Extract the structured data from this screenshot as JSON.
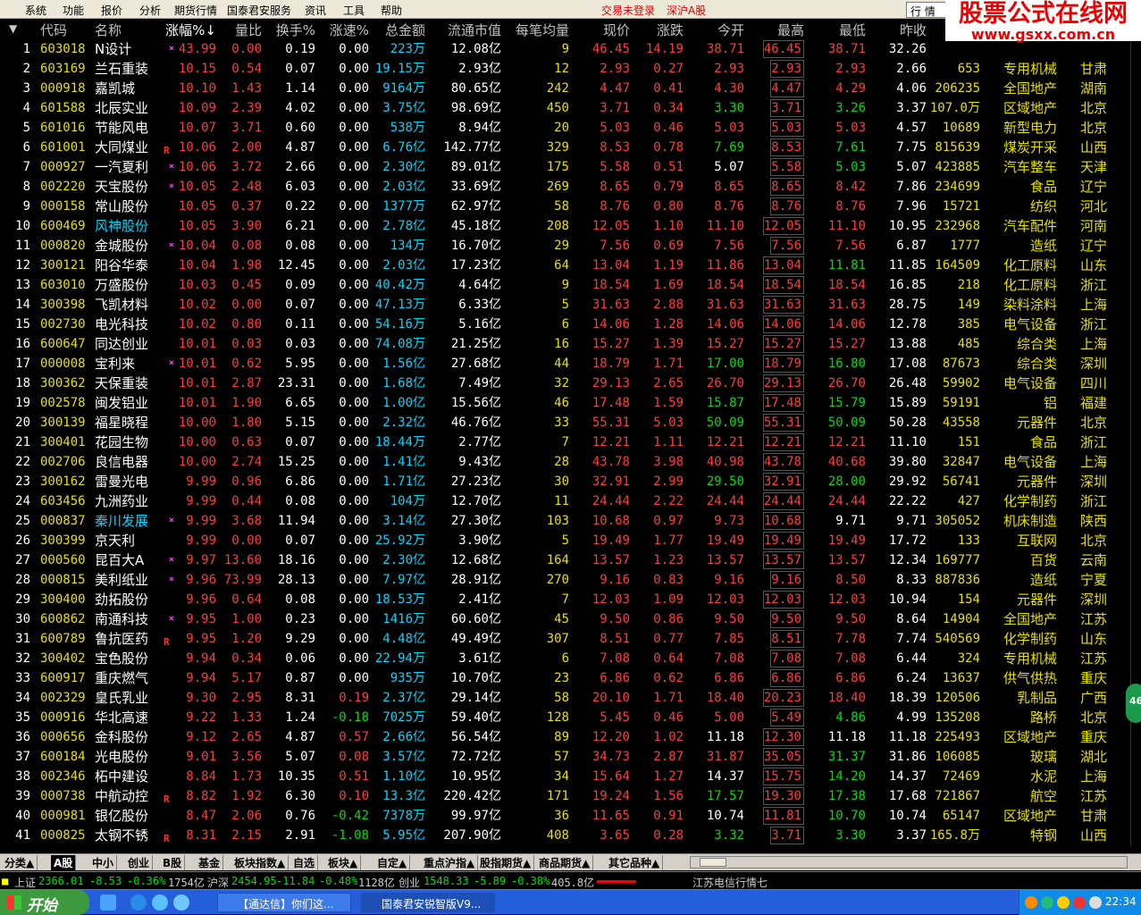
{
  "menu": [
    "系统",
    "功能",
    "报价",
    "分析",
    "期货行情",
    "国泰君安服务",
    "资讯",
    "工具",
    "帮助"
  ],
  "login_status": "交易未登录",
  "market": "深沪A股",
  "quote_button": "行 情",
  "watermark": {
    "title": "股票公式在线网",
    "url": "www.gsxx.com.cn"
  },
  "headers": [
    "代码",
    "名称",
    "涨幅%↓",
    "量比",
    "换手%",
    "涨速%",
    "总金额",
    "流通市值",
    "每笔均量",
    "现价",
    "涨跌",
    "今开",
    "最高",
    "最低",
    "昨收",
    "",
    ""
  ],
  "menu_arrow": "▼",
  "colors": {
    "up": "#ff3c3c",
    "down": "#00e000",
    "flat": "#ffffff",
    "yellow": "#e8e000",
    "cyan": "#00d8ff",
    "code": "#e8e000",
    "volume": "#e8e000",
    "header": "#c0c0c0"
  },
  "rows": [
    [
      "1",
      "603018",
      "N设计",
      "×",
      "43.99",
      "0.00",
      "0.19",
      "0.00",
      "223万",
      "12.08亿",
      "9",
      "46.45",
      "14.19",
      "38.71",
      "46.45",
      "38.71",
      "32.26",
      "",
      ""
    ],
    [
      "2",
      "603169",
      "兰石重装",
      "",
      "10.15",
      "0.54",
      "0.07",
      "0.00",
      "19.15万",
      "2.93亿",
      "12",
      "2.93",
      "0.27",
      "2.93",
      "2.93",
      "2.93",
      "2.66",
      "653",
      "专用机械",
      "甘肃"
    ],
    [
      "3",
      "000918",
      "嘉凯城",
      "",
      "10.10",
      "1.43",
      "1.14",
      "0.00",
      "9164万",
      "80.65亿",
      "242",
      "4.47",
      "0.41",
      "4.30",
      "4.47",
      "4.29",
      "4.06",
      "206235",
      "全国地产",
      "湖南"
    ],
    [
      "4",
      "601588",
      "北辰实业",
      "",
      "10.09",
      "2.39",
      "4.02",
      "0.00",
      "3.75亿",
      "98.69亿",
      "450",
      "3.71",
      "0.34",
      "3.30",
      "3.71",
      "3.26",
      "3.37",
      "107.0万",
      "区域地产",
      "北京"
    ],
    [
      "5",
      "601016",
      "节能风电",
      "",
      "10.07",
      "3.71",
      "0.60",
      "0.00",
      "538万",
      "8.94亿",
      "20",
      "5.03",
      "0.46",
      "5.03",
      "5.03",
      "5.03",
      "4.57",
      "10689",
      "新型电力",
      "北京"
    ],
    [
      "6",
      "601001",
      "大同煤业",
      "R",
      "10.06",
      "2.00",
      "4.87",
      "0.00",
      "6.76亿",
      "142.77亿",
      "329",
      "8.53",
      "0.78",
      "7.69",
      "8.53",
      "7.61",
      "7.75",
      "815639",
      "煤炭开采",
      "山西"
    ],
    [
      "7",
      "000927",
      "一汽夏利",
      "×",
      "10.06",
      "3.72",
      "2.66",
      "0.00",
      "2.30亿",
      "89.01亿",
      "175",
      "5.58",
      "0.51",
      "5.07",
      "5.58",
      "5.03",
      "5.07",
      "423885",
      "汽车整车",
      "天津"
    ],
    [
      "8",
      "002220",
      "天宝股份",
      "×",
      "10.05",
      "2.48",
      "6.03",
      "0.00",
      "2.03亿",
      "33.69亿",
      "269",
      "8.65",
      "0.79",
      "8.65",
      "8.65",
      "8.42",
      "7.86",
      "234699",
      "食品",
      "辽宁"
    ],
    [
      "9",
      "000158",
      "常山股份",
      "",
      "10.05",
      "0.37",
      "0.22",
      "0.00",
      "1377万",
      "62.97亿",
      "58",
      "8.76",
      "0.80",
      "8.76",
      "8.76",
      "8.76",
      "7.96",
      "15721",
      "纺织",
      "河北"
    ],
    [
      "10",
      "600469",
      "风神股份",
      "",
      "10.05",
      "3.90",
      "6.21",
      "0.00",
      "2.78亿",
      "45.18亿",
      "208",
      "12.05",
      "1.10",
      "11.10",
      "12.05",
      "11.10",
      "10.95",
      "232968",
      "汽车配件",
      "河南"
    ],
    [
      "11",
      "000820",
      "金城股份",
      "×",
      "10.04",
      "0.08",
      "0.08",
      "0.00",
      "134万",
      "16.70亿",
      "29",
      "7.56",
      "0.69",
      "7.56",
      "7.56",
      "7.56",
      "6.87",
      "1777",
      "造纸",
      "辽宁"
    ],
    [
      "12",
      "300121",
      "阳谷华泰",
      "",
      "10.04",
      "1.98",
      "12.45",
      "0.00",
      "2.03亿",
      "17.23亿",
      "64",
      "13.04",
      "1.19",
      "11.86",
      "13.04",
      "11.81",
      "11.85",
      "164509",
      "化工原料",
      "山东"
    ],
    [
      "13",
      "603010",
      "万盛股份",
      "",
      "10.03",
      "0.45",
      "0.09",
      "0.00",
      "40.42万",
      "4.64亿",
      "9",
      "18.54",
      "1.69",
      "18.54",
      "18.54",
      "18.54",
      "16.85",
      "218",
      "化工原料",
      "浙江"
    ],
    [
      "14",
      "300398",
      "飞凯材料",
      "",
      "10.02",
      "0.00",
      "0.07",
      "0.00",
      "47.13万",
      "6.33亿",
      "5",
      "31.63",
      "2.88",
      "31.63",
      "31.63",
      "31.63",
      "28.75",
      "149",
      "染料涂料",
      "上海"
    ],
    [
      "15",
      "002730",
      "电光科技",
      "",
      "10.02",
      "0.80",
      "0.11",
      "0.00",
      "54.16万",
      "5.16亿",
      "6",
      "14.06",
      "1.28",
      "14.06",
      "14.06",
      "14.06",
      "12.78",
      "385",
      "电气设备",
      "浙江"
    ],
    [
      "16",
      "600647",
      "同达创业",
      "",
      "10.01",
      "0.03",
      "0.03",
      "0.00",
      "74.08万",
      "21.25亿",
      "16",
      "15.27",
      "1.39",
      "15.27",
      "15.27",
      "15.27",
      "13.88",
      "485",
      "综合类",
      "上海"
    ],
    [
      "17",
      "000008",
      "宝利来",
      "×",
      "10.01",
      "0.62",
      "5.95",
      "0.00",
      "1.56亿",
      "27.68亿",
      "44",
      "18.79",
      "1.71",
      "17.00",
      "18.79",
      "16.80",
      "17.08",
      "87673",
      "综合类",
      "深圳"
    ],
    [
      "18",
      "300362",
      "天保重装",
      "",
      "10.01",
      "2.87",
      "23.31",
      "0.00",
      "1.68亿",
      "7.49亿",
      "32",
      "29.13",
      "2.65",
      "26.70",
      "29.13",
      "26.70",
      "26.48",
      "59902",
      "电气设备",
      "四川"
    ],
    [
      "19",
      "002578",
      "闽发铝业",
      "",
      "10.01",
      "1.90",
      "6.65",
      "0.00",
      "1.00亿",
      "15.56亿",
      "46",
      "17.48",
      "1.59",
      "15.87",
      "17.48",
      "15.79",
      "15.89",
      "59191",
      "铝",
      "福建"
    ],
    [
      "20",
      "300139",
      "福星晓程",
      "",
      "10.00",
      "1.80",
      "5.15",
      "0.00",
      "2.32亿",
      "46.76亿",
      "33",
      "55.31",
      "5.03",
      "50.09",
      "55.31",
      "50.09",
      "50.28",
      "43558",
      "元器件",
      "北京"
    ],
    [
      "21",
      "300401",
      "花园生物",
      "",
      "10.00",
      "0.63",
      "0.07",
      "0.00",
      "18.44万",
      "2.77亿",
      "7",
      "12.21",
      "1.11",
      "12.21",
      "12.21",
      "12.21",
      "11.10",
      "151",
      "食品",
      "浙江"
    ],
    [
      "22",
      "002706",
      "良信电器",
      "",
      "10.00",
      "2.74",
      "15.25",
      "0.00",
      "1.41亿",
      "9.43亿",
      "28",
      "43.78",
      "3.98",
      "40.98",
      "43.78",
      "40.68",
      "39.80",
      "32847",
      "电气设备",
      "上海"
    ],
    [
      "23",
      "300162",
      "雷曼光电",
      "",
      "9.99",
      "0.96",
      "6.86",
      "0.00",
      "1.71亿",
      "27.23亿",
      "30",
      "32.91",
      "2.99",
      "29.50",
      "32.91",
      "28.00",
      "29.92",
      "56741",
      "元器件",
      "深圳"
    ],
    [
      "24",
      "603456",
      "九洲药业",
      "",
      "9.99",
      "0.44",
      "0.08",
      "0.00",
      "104万",
      "12.70亿",
      "11",
      "24.44",
      "2.22",
      "24.44",
      "24.44",
      "24.44",
      "22.22",
      "427",
      "化学制药",
      "浙江"
    ],
    [
      "25",
      "000837",
      "秦川发展",
      "×",
      "9.99",
      "3.68",
      "11.94",
      "0.00",
      "3.14亿",
      "27.30亿",
      "103",
      "10.68",
      "0.97",
      "9.73",
      "10.68",
      "9.71",
      "9.71",
      "305052",
      "机床制造",
      "陕西"
    ],
    [
      "26",
      "300399",
      "京天利",
      "",
      "9.99",
      "0.00",
      "0.07",
      "0.00",
      "25.92万",
      "3.90亿",
      "5",
      "19.49",
      "1.77",
      "19.49",
      "19.49",
      "19.49",
      "17.72",
      "133",
      "互联网",
      "北京"
    ],
    [
      "27",
      "000560",
      "昆百大A",
      "×",
      "9.97",
      "13.60",
      "18.16",
      "0.00",
      "2.30亿",
      "12.68亿",
      "164",
      "13.57",
      "1.23",
      "13.57",
      "13.57",
      "13.57",
      "12.34",
      "169777",
      "百货",
      "云南"
    ],
    [
      "28",
      "000815",
      "美利纸业",
      "×",
      "9.96",
      "73.99",
      "28.13",
      "0.00",
      "7.97亿",
      "28.91亿",
      "270",
      "9.16",
      "0.83",
      "9.16",
      "9.16",
      "8.50",
      "8.33",
      "887836",
      "造纸",
      "宁夏"
    ],
    [
      "29",
      "300400",
      "劲拓股份",
      "",
      "9.96",
      "0.64",
      "0.08",
      "0.00",
      "18.53万",
      "2.41亿",
      "7",
      "12.03",
      "1.09",
      "12.03",
      "12.03",
      "12.03",
      "10.94",
      "154",
      "元器件",
      "深圳"
    ],
    [
      "30",
      "600862",
      "南通科技",
      "×",
      "9.95",
      "1.00",
      "0.23",
      "0.00",
      "1416万",
      "60.60亿",
      "45",
      "9.50",
      "0.86",
      "9.50",
      "9.50",
      "9.50",
      "8.64",
      "14904",
      "全国地产",
      "江苏"
    ],
    [
      "31",
      "600789",
      "鲁抗医药",
      "R",
      "9.95",
      "1.20",
      "9.29",
      "0.00",
      "4.48亿",
      "49.49亿",
      "307",
      "8.51",
      "0.77",
      "7.85",
      "8.51",
      "7.78",
      "7.74",
      "540569",
      "化学制药",
      "山东"
    ],
    [
      "32",
      "300402",
      "宝色股份",
      "",
      "9.94",
      "0.34",
      "0.06",
      "0.00",
      "22.94万",
      "3.61亿",
      "6",
      "7.08",
      "0.64",
      "7.08",
      "7.08",
      "7.08",
      "6.44",
      "324",
      "专用机械",
      "江苏"
    ],
    [
      "33",
      "600917",
      "重庆燃气",
      "",
      "9.94",
      "5.17",
      "0.87",
      "0.00",
      "935万",
      "10.70亿",
      "23",
      "6.86",
      "0.62",
      "6.86",
      "6.86",
      "6.86",
      "6.24",
      "13637",
      "供气供热",
      "重庆"
    ],
    [
      "34",
      "002329",
      "皇氏乳业",
      "",
      "9.30",
      "2.95",
      "8.31",
      "0.19",
      "2.37亿",
      "29.14亿",
      "58",
      "20.10",
      "1.71",
      "18.40",
      "20.23",
      "18.40",
      "18.39",
      "120506",
      "乳制品",
      "广西"
    ],
    [
      "35",
      "000916",
      "华北高速",
      "",
      "9.22",
      "1.33",
      "1.24",
      "-0.18",
      "7025万",
      "59.40亿",
      "128",
      "5.45",
      "0.46",
      "5.00",
      "5.49",
      "4.86",
      "4.99",
      "135208",
      "路桥",
      "北京"
    ],
    [
      "36",
      "000656",
      "金科股份",
      "",
      "9.12",
      "2.65",
      "4.87",
      "0.57",
      "2.66亿",
      "56.54亿",
      "89",
      "12.20",
      "1.02",
      "11.18",
      "12.30",
      "11.18",
      "11.18",
      "225493",
      "区域地产",
      "重庆"
    ],
    [
      "37",
      "600184",
      "光电股份",
      "",
      "9.01",
      "3.56",
      "5.07",
      "0.08",
      "3.57亿",
      "72.72亿",
      "57",
      "34.73",
      "2.87",
      "31.87",
      "35.05",
      "31.37",
      "31.86",
      "106085",
      "玻璃",
      "湖北"
    ],
    [
      "38",
      "002346",
      "柘中建设",
      "",
      "8.84",
      "1.73",
      "10.35",
      "0.51",
      "1.10亿",
      "10.95亿",
      "34",
      "15.64",
      "1.27",
      "14.37",
      "15.75",
      "14.20",
      "14.37",
      "72469",
      "水泥",
      "上海"
    ],
    [
      "39",
      "000738",
      "中航动控",
      "R",
      "8.82",
      "1.92",
      "6.30",
      "0.10",
      "13.3亿",
      "220.42亿",
      "171",
      "19.24",
      "1.56",
      "17.57",
      "19.30",
      "17.38",
      "17.68",
      "721867",
      "航空",
      "江苏"
    ],
    [
      "40",
      "000981",
      "银亿股份",
      "",
      "8.47",
      "2.06",
      "0.76",
      "-0.42",
      "7378万",
      "99.97亿",
      "36",
      "11.65",
      "0.91",
      "10.74",
      "11.81",
      "10.70",
      "10.74",
      "65147",
      "区域地产",
      "甘肃"
    ],
    [
      "41",
      "000825",
      "太钢不锈",
      "R",
      "8.31",
      "2.15",
      "2.91",
      "-1.08",
      "5.95亿",
      "207.90亿",
      "408",
      "3.65",
      "0.28",
      "3.32",
      "3.71",
      "3.30",
      "3.37",
      "165.8万",
      "特钢",
      "山西"
    ]
  ],
  "tabs": [
    "分类▲",
    "A股",
    "中小",
    "创业",
    "B股",
    "基金",
    "板块指数▲",
    "自选",
    "板块▲",
    "自定▲",
    "重点沪指▲",
    "股指期货▲",
    "商品期货▲",
    "其它品种▲"
  ],
  "status": {
    "sh_label": "上证",
    "sh_value": "2366.01",
    "sh_change": "-8.53",
    "sh_pct": "-0.36%",
    "sh_amount": "1754亿",
    "hs_label": "沪深",
    "hs_value": "2454.95",
    "hs_change": "-11.84",
    "hs_pct": "-0.48%",
    "hs_amount": "1128亿",
    "cy_label": "创业",
    "cy_value": "1548.33",
    "cy_change": "-5.89",
    "cy_pct": "-0.38%",
    "cy_amount": "405.8亿",
    "server": "江苏电信行情七"
  },
  "side_badge": "46",
  "taskbar": {
    "start": "开始",
    "tasks": [
      "【通达信】你们这...",
      "国泰君安锐智版V9..."
    ],
    "clock": "22:34"
  }
}
